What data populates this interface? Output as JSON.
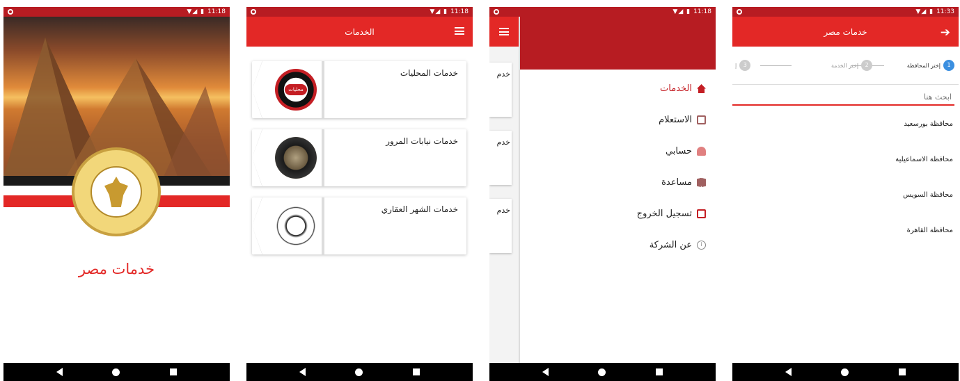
{
  "status": {
    "time1": "11:18",
    "time2": "11:18",
    "time3": "11:18",
    "time4": "11:33"
  },
  "screen1": {
    "app_title": "خدمات مصر"
  },
  "screen2": {
    "appbar_title": "الخدمات",
    "cards": [
      {
        "label": "خدمات المحليات",
        "logo_text": "محليات"
      },
      {
        "label": "خدمات نيابات المرور"
      },
      {
        "label": "خدمات الشهر العقاري"
      }
    ]
  },
  "screen3": {
    "mini_card_label": "خدم",
    "menu": [
      {
        "label": "الخدمات",
        "icon": "home-icon"
      },
      {
        "label": "الاستعلام",
        "icon": "search-doc-icon"
      },
      {
        "label": "حسابي",
        "icon": "user-icon"
      },
      {
        "label": "مساعدة",
        "icon": "book-icon"
      },
      {
        "label": "تسجيل الخروج",
        "icon": "logout-icon"
      },
      {
        "label": "عن الشركة",
        "icon": "info-icon"
      }
    ]
  },
  "screen4": {
    "appbar_title": "خدمات مصر",
    "steps": [
      {
        "num": "1",
        "label": "إختر المحافظة"
      },
      {
        "num": "2",
        "label": "إختر الخدمة"
      },
      {
        "num": "3",
        "label": "إ"
      }
    ],
    "search_placeholder": "ابحث هنا",
    "governorates": [
      "محافظة بورسعيد",
      "محافظة الاسماعيلية",
      "محافظة السويس",
      "محافظة القاهرة"
    ]
  },
  "colors": {
    "accent": "#e32826",
    "status_bar": "#b71c22",
    "step_active": "#3b8fe0"
  }
}
